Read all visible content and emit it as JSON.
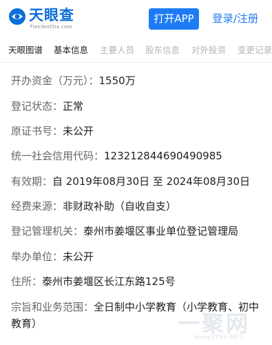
{
  "header": {
    "logo_title": "天眼查",
    "logo_sub": "TianYanCha.com",
    "open_app_label": "打开APP",
    "login_label": "登录/注册"
  },
  "tabs": [
    {
      "label": "天眼图谱",
      "active": true
    },
    {
      "label": "基本信息",
      "active": true
    },
    {
      "label": "主要人员",
      "active": false
    },
    {
      "label": "股东信息",
      "active": false
    },
    {
      "label": "对外投资",
      "active": false
    },
    {
      "label": "变更记录",
      "active": false
    }
  ],
  "details": [
    {
      "label": "开办资金（万元）：",
      "value": "1550万"
    },
    {
      "label": "登记状态：",
      "value": "正常"
    },
    {
      "label": "原证书号：",
      "value": "未公开"
    },
    {
      "label": "统一社会信用代码：",
      "value": "123212844690490985"
    },
    {
      "label": "有效期：",
      "value": "自 2019年08月30日 至 2024年08月30日"
    },
    {
      "label": "经费来源：",
      "value": "非财政补助（自收自支）"
    },
    {
      "label": "登记管理机关：",
      "value": "泰州市姜堰区事业单位登记管理局"
    },
    {
      "label": "举办单位：",
      "value": "未公开"
    },
    {
      "label": "住所：",
      "value": "泰州市姜堰区长江东路125号"
    },
    {
      "label": "宗旨和业务范围：",
      "value": "全日制中小学教育（小学教育、初中教育）"
    }
  ],
  "watermark": {
    "text": "一聚网",
    "url": "www.JYSS.NET"
  },
  "colors": {
    "brand_blue": "#1e7bf5",
    "logo_blue": "#0b6fd9",
    "label_gray": "#666666",
    "value_dark": "#222222",
    "tab_inactive": "#b4b4b4"
  }
}
